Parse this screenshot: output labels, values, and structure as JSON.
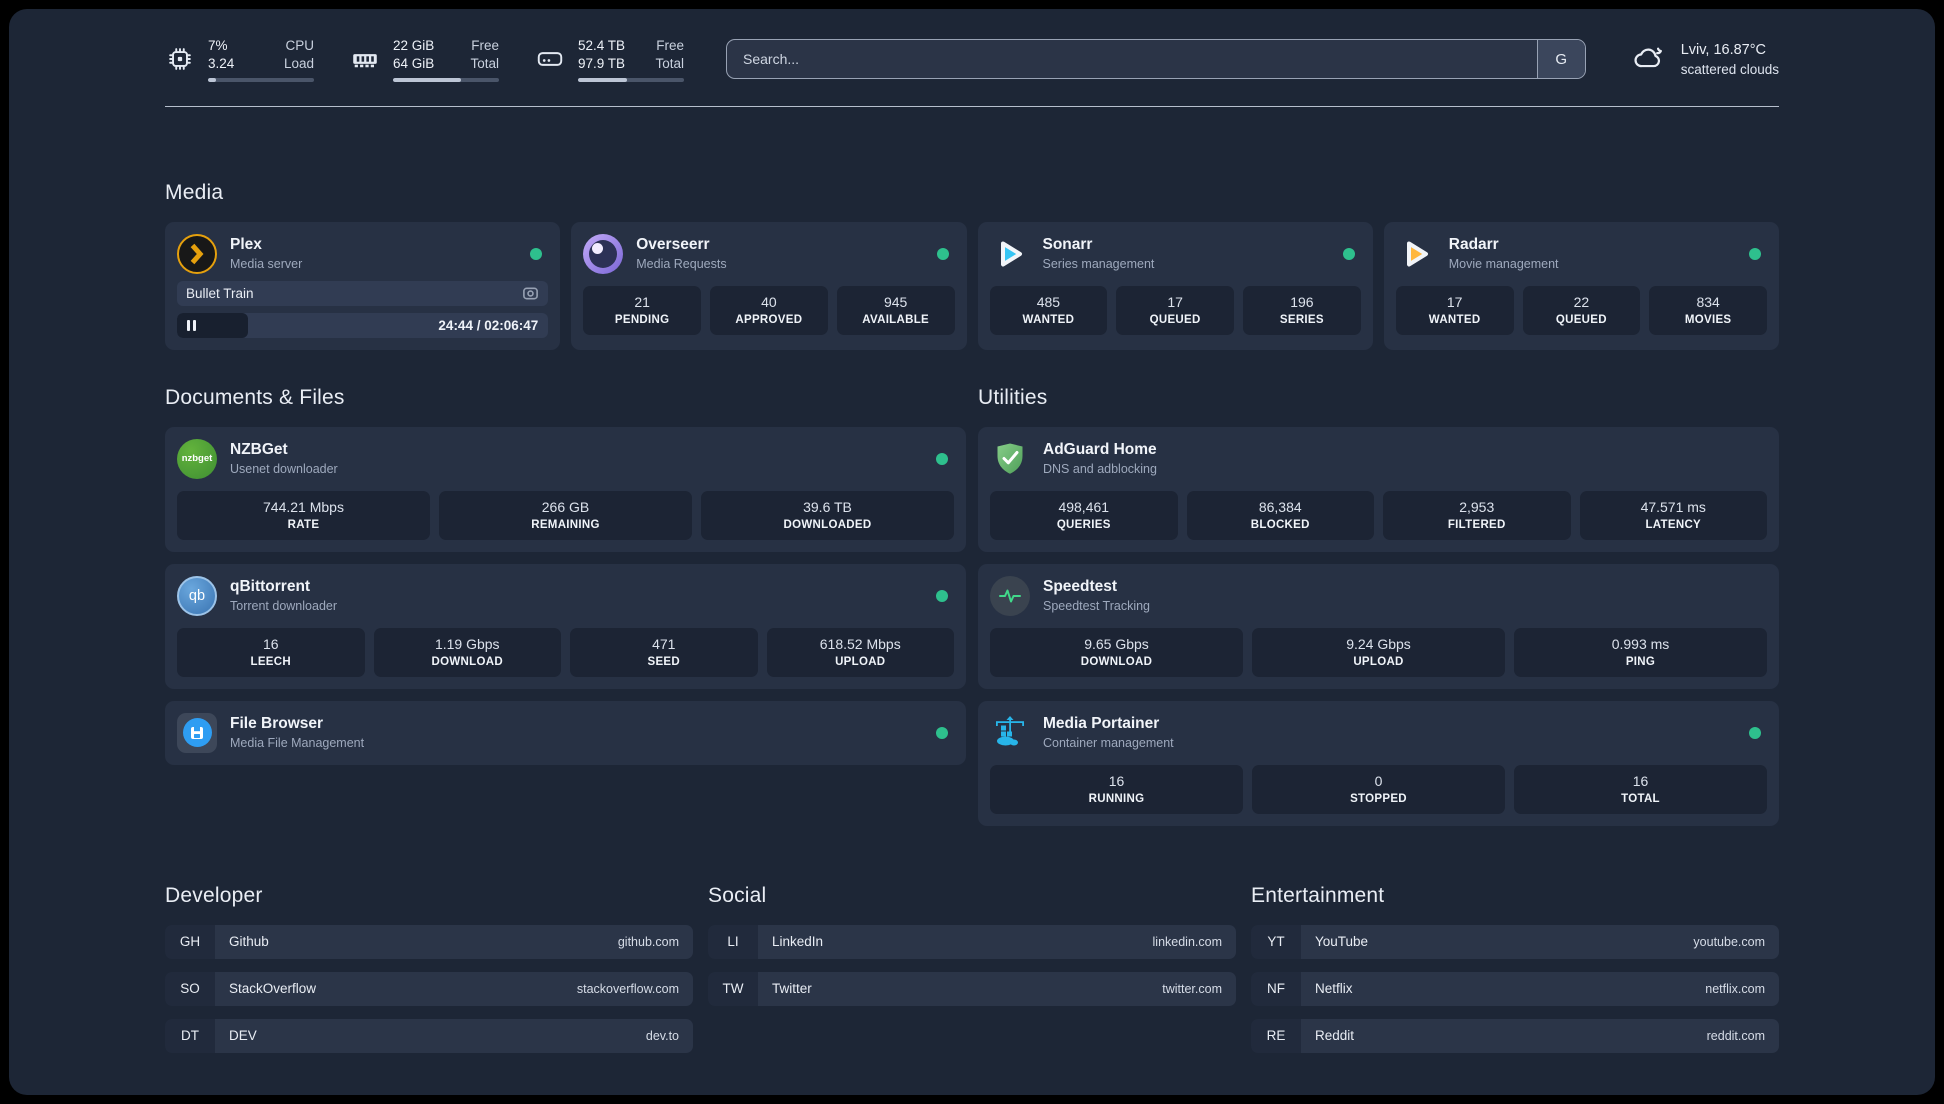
{
  "colors": {
    "status_online": "#2ec08d",
    "plex_amber": "#e5a00d",
    "sonarr_blue": "#35c5f4",
    "radarr_yellow": "#ffb73d",
    "nzbget_green": "#4ea23c",
    "qbittorrent_blue": "#4688c7",
    "filebrowser_blue": "#2e9df2",
    "adguard_green": "#68bc71",
    "speedtest_line_green": "#41d98a",
    "portainer_blue": "#27b5e9"
  },
  "topbar": {
    "resources": [
      {
        "icon": "cpu-icon",
        "rows": [
          {
            "value": "7%",
            "label": "CPU"
          },
          {
            "value": "3.24",
            "label": "Load"
          }
        ],
        "progress_pct": 8
      },
      {
        "icon": "memory-icon",
        "rows": [
          {
            "value": "22 GiB",
            "label": "Free"
          },
          {
            "value": "64 GiB",
            "label": "Total"
          }
        ],
        "progress_pct": 64
      },
      {
        "icon": "disk-icon",
        "rows": [
          {
            "value": "52.4 TB",
            "label": "Free"
          },
          {
            "value": "97.9 TB",
            "label": "Total"
          }
        ],
        "progress_pct": 46
      }
    ],
    "search": {
      "placeholder": "Search...",
      "provider_button": "G"
    },
    "weather": {
      "summary": "Lviv, 16.87°C",
      "condition": "scattered clouds"
    }
  },
  "sections": {
    "media": {
      "title": "Media",
      "cards": [
        {
          "name": "Plex",
          "description": "Media server",
          "status": "online",
          "player": {
            "title": "Bullet Train",
            "time_display": "24:44 / 02:06:47",
            "progress_pct": 19
          }
        },
        {
          "name": "Overseerr",
          "description": "Media Requests",
          "status": "online",
          "stats": [
            {
              "value": "21",
              "label": "PENDING"
            },
            {
              "value": "40",
              "label": "APPROVED"
            },
            {
              "value": "945",
              "label": "AVAILABLE"
            }
          ]
        },
        {
          "name": "Sonarr",
          "description": "Series management",
          "status": "online",
          "stats": [
            {
              "value": "485",
              "label": "WANTED"
            },
            {
              "value": "17",
              "label": "QUEUED"
            },
            {
              "value": "196",
              "label": "SERIES"
            }
          ]
        },
        {
          "name": "Radarr",
          "description": "Movie management",
          "status": "online",
          "stats": [
            {
              "value": "17",
              "label": "WANTED"
            },
            {
              "value": "22",
              "label": "QUEUED"
            },
            {
              "value": "834",
              "label": "MOVIES"
            }
          ]
        }
      ]
    },
    "documents": {
      "title": "Documents & Files",
      "cards": [
        {
          "name": "NZBGet",
          "description": "Usenet downloader",
          "status": "online",
          "logo_text": "nzbget",
          "stats": [
            {
              "value": "744.21 Mbps",
              "label": "RATE"
            },
            {
              "value": "266 GB",
              "label": "REMAINING"
            },
            {
              "value": "39.6 TB",
              "label": "DOWNLOADED"
            }
          ]
        },
        {
          "name": "qBittorrent",
          "description": "Torrent downloader",
          "status": "online",
          "logo_text": "qb",
          "stats": [
            {
              "value": "16",
              "label": "LEECH"
            },
            {
              "value": "1.19 Gbps",
              "label": "DOWNLOAD"
            },
            {
              "value": "471",
              "label": "SEED"
            },
            {
              "value": "618.52 Mbps",
              "label": "UPLOAD"
            }
          ]
        },
        {
          "name": "File Browser",
          "description": "Media File Management",
          "status": "online"
        }
      ]
    },
    "utilities": {
      "title": "Utilities",
      "cards": [
        {
          "name": "AdGuard Home",
          "description": "DNS and adblocking",
          "stats": [
            {
              "value": "498,461",
              "label": "QUERIES"
            },
            {
              "value": "86,384",
              "label": "BLOCKED"
            },
            {
              "value": "2,953",
              "label": "FILTERED"
            },
            {
              "value": "47.571 ms",
              "label": "LATENCY"
            }
          ]
        },
        {
          "name": "Speedtest",
          "description": "Speedtest Tracking",
          "stats": [
            {
              "value": "9.65 Gbps",
              "label": "DOWNLOAD"
            },
            {
              "value": "9.24 Gbps",
              "label": "UPLOAD"
            },
            {
              "value": "0.993 ms",
              "label": "PING"
            }
          ]
        },
        {
          "name": "Media Portainer",
          "description": "Container management",
          "status": "online",
          "stats": [
            {
              "value": "16",
              "label": "RUNNING"
            },
            {
              "value": "0",
              "label": "STOPPED"
            },
            {
              "value": "16",
              "label": "TOTAL"
            }
          ]
        }
      ]
    }
  },
  "bookmarks": [
    {
      "title": "Developer",
      "items": [
        {
          "abbr": "GH",
          "name": "Github",
          "domain": "github.com"
        },
        {
          "abbr": "SO",
          "name": "StackOverflow",
          "domain": "stackoverflow.com"
        },
        {
          "abbr": "DT",
          "name": "DEV",
          "domain": "dev.to"
        }
      ]
    },
    {
      "title": "Social",
      "items": [
        {
          "abbr": "LI",
          "name": "LinkedIn",
          "domain": "linkedin.com"
        },
        {
          "abbr": "TW",
          "name": "Twitter",
          "domain": "twitter.com"
        }
      ]
    },
    {
      "title": "Entertainment",
      "items": [
        {
          "abbr": "YT",
          "name": "YouTube",
          "domain": "youtube.com"
        },
        {
          "abbr": "NF",
          "name": "Netflix",
          "domain": "netflix.com"
        },
        {
          "abbr": "RE",
          "name": "Reddit",
          "domain": "reddit.com"
        }
      ]
    }
  ]
}
